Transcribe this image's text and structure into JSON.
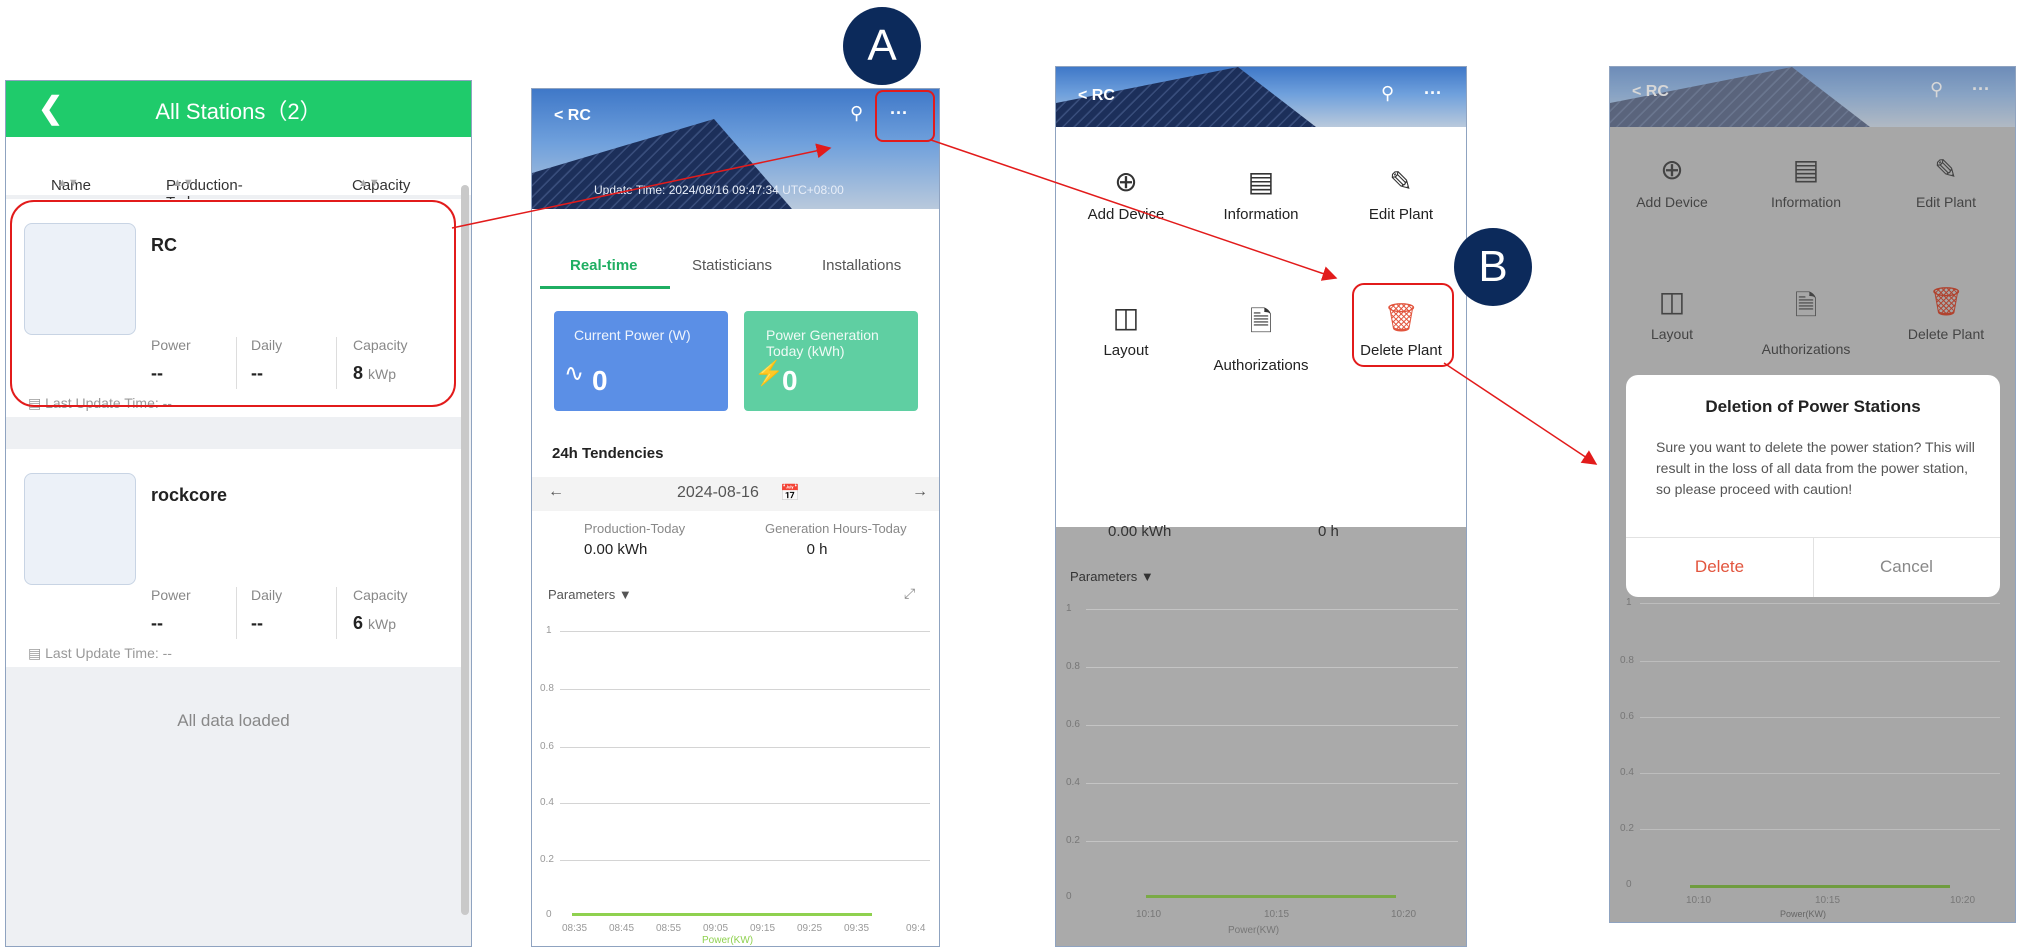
{
  "screen1": {
    "title": "All Stations（2）",
    "sort": [
      "Name",
      "Production-Today",
      "Capacity"
    ],
    "stations": [
      {
        "name": "RC",
        "power_label": "Power",
        "power": "--",
        "daily_label": "Daily",
        "daily": "--",
        "capacity_label": "Capacity",
        "capacity": "8",
        "capacity_unit": "kWp",
        "last_update": "Last Update Time: --"
      },
      {
        "name": "rockcore",
        "power_label": "Power",
        "power": "--",
        "daily_label": "Daily",
        "daily": "--",
        "capacity_label": "Capacity",
        "capacity": "6",
        "capacity_unit": "kWp",
        "last_update": "Last Update Time: --"
      }
    ],
    "footer": "All data loaded"
  },
  "screen2": {
    "title": "RC",
    "update_time": "Update Time:  2024/08/16 09:47:34 UTC+08:00",
    "tabs": [
      "Real-time",
      "Statisticians",
      "Installations"
    ],
    "current_power_label": "Current Power (W)",
    "current_power_value": "0",
    "gen_today_label_1": "Power Generation",
    "gen_today_label_2": "Today (kWh)",
    "gen_today_value": "0",
    "tendencies": "24h Tendencies",
    "date": "2024-08-16",
    "production_today_label": "Production-Today",
    "production_today_value": "0.00 kWh",
    "gen_hours_label": "Generation Hours-Today",
    "gen_hours_value": "0 h",
    "parameters": "Parameters",
    "y_ticks": [
      "1",
      "0.8",
      "0.6",
      "0.4",
      "0.2",
      "0"
    ],
    "x_ticks": [
      "08:35",
      "08:45",
      "08:55",
      "09:05",
      "09:15",
      "09:25",
      "09:35",
      "09:4"
    ],
    "legend": "Power(KW)"
  },
  "screen3": {
    "title": "RC",
    "menu": [
      {
        "label": "Add Device",
        "icon": "plus-circle-icon"
      },
      {
        "label": "Information",
        "icon": "list-icon"
      },
      {
        "label": "Edit Plant",
        "icon": "pencil-icon"
      },
      {
        "label": "Layout",
        "icon": "layout-icon"
      },
      {
        "label": "Authorizations",
        "icon": "document-user-icon"
      },
      {
        "label": "Delete Plant",
        "icon": "trash-icon"
      }
    ],
    "peek_production": "0.00 kWh",
    "peek_hours": "0 h",
    "parameters": "Parameters",
    "y_ticks": [
      "1",
      "0.8",
      "0.6",
      "0.4",
      "0.2",
      "0"
    ],
    "x_ticks": [
      "10:10",
      "10:15",
      "10:20"
    ],
    "legend": "Power(KW)"
  },
  "screen4": {
    "title": "RC",
    "menu": [
      "Add Device",
      "Information",
      "Edit Plant",
      "Layout",
      "Authorizations",
      "Delete Plant"
    ],
    "dialog_title": "Deletion of Power Stations",
    "dialog_body": "Sure you want to delete the power station? This will result in the loss of all data from the power station, so please proceed with caution!",
    "delete": "Delete",
    "cancel": "Cancel",
    "y_ticks": [
      "1",
      "0.8",
      "0.6",
      "0.4",
      "0.2",
      "0"
    ],
    "x_ticks": [
      "10:10",
      "10:15",
      "10:20"
    ],
    "legend": "Power(KW)"
  },
  "callouts": {
    "a": "A",
    "b": "B"
  },
  "colors": {
    "accent_green": "#1fcb6b",
    "tile_blue": "#5b8fe6",
    "tile_green": "#5fcfa2",
    "delete_red": "#e2553e",
    "callout_navy": "#0c2a5b",
    "arrow_red": "#e21b1b"
  }
}
